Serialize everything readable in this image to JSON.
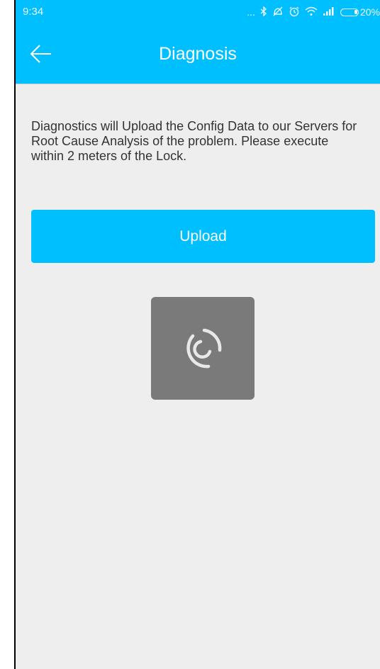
{
  "status_bar": {
    "time": "9:34",
    "more_glyph": "...",
    "battery_text": "20%",
    "icons": [
      "more-icon",
      "bluetooth-icon",
      "do-not-disturb-icon",
      "alarm-icon",
      "wifi-icon",
      "signal-icon",
      "battery-icon"
    ]
  },
  "header": {
    "title": "Diagnosis",
    "back_icon": "back-arrow-icon"
  },
  "main": {
    "description": "Diagnostics will Upload the Config Data to our Servers for Root Cause Analysis of the problem. Please execute within 2 meters of the Lock.",
    "upload_label": "Upload",
    "loading_icon": "spinner-icon"
  },
  "colors": {
    "accent": "#00bfff",
    "background": "#eeeeee",
    "text": "#333333",
    "loader_bg": "#7a7a7a"
  }
}
